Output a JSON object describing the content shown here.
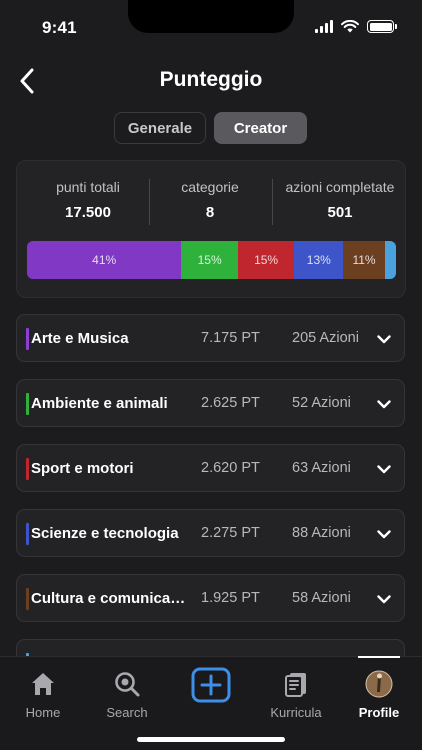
{
  "status": {
    "time": "9:41"
  },
  "header": {
    "title": "Punteggio"
  },
  "tabs": {
    "generale": "Generale",
    "creator": "Creator",
    "selected": "Creator"
  },
  "summary": {
    "stats": [
      {
        "label": "punti totali",
        "value": "17.500"
      },
      {
        "label": "categorie",
        "value": "8"
      },
      {
        "label": "azioni completate",
        "value": "501"
      }
    ],
    "distribution": [
      {
        "label": "41%",
        "percent": 41,
        "color": "#8138c4"
      },
      {
        "label": "15%",
        "percent": 15,
        "color": "#2eb23c"
      },
      {
        "label": "15%",
        "percent": 15,
        "color": "#c0262e"
      },
      {
        "label": "13%",
        "percent": 13,
        "color": "#3d55c9"
      },
      {
        "label": "11%",
        "percent": 11,
        "color": "#6b3f20"
      },
      {
        "label": "",
        "percent": 3,
        "color": "#4aa3df"
      }
    ]
  },
  "categories": [
    {
      "name": "Arte e Musica",
      "points": "7.175 PT",
      "actions": "205 Azioni",
      "color": "#8b3fd6"
    },
    {
      "name": "Ambiente e animali",
      "points": "2.625 PT",
      "actions": "52 Azioni",
      "color": "#2eb23c"
    },
    {
      "name": "Sport e motori",
      "points": "2.620 PT",
      "actions": "63 Azioni",
      "color": "#c0262e"
    },
    {
      "name": "Scienze e tecnologia",
      "points": "2.275 PT",
      "actions": "88 Azioni",
      "color": "#3d55c9"
    },
    {
      "name": "Cultura e comunicazione",
      "points": "1.925 PT",
      "actions": "58 Azioni",
      "color": "#6b3f20"
    },
    {
      "name": "",
      "points": "",
      "actions": "",
      "color": "#4aa3df"
    }
  ],
  "tabbar": {
    "home": "Home",
    "search": "Search",
    "add": "",
    "curricula": "Kurricula",
    "profile": "Profile",
    "active": "Profile"
  }
}
